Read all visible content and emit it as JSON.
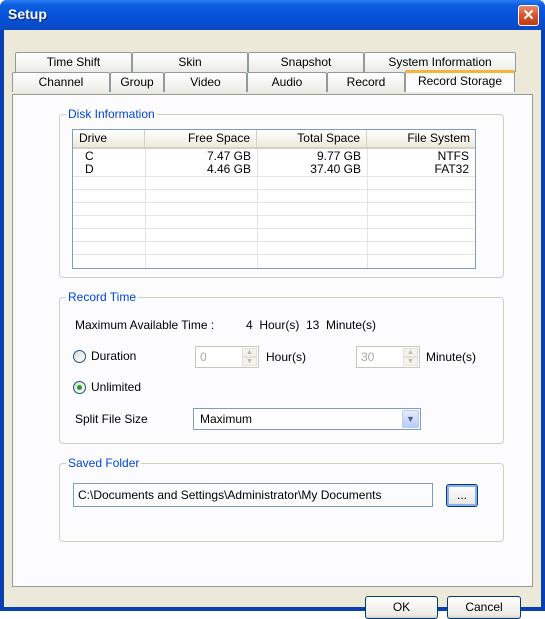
{
  "window": {
    "title": "Setup",
    "close_glyph": "✕"
  },
  "tabs_row1": [
    "Time Shift",
    "Skin",
    "Snapshot",
    "System Information"
  ],
  "tabs_row2": [
    "Channel",
    "Group",
    "Video",
    "Audio",
    "Record",
    "Record Storage"
  ],
  "active_tab": "Record Storage",
  "disk_info": {
    "legend": "Disk Information",
    "columns": [
      "Drive",
      "Free Space",
      "Total Space",
      "File System"
    ],
    "rows": [
      [
        "C",
        "7.47 GB",
        "9.77 GB",
        "NTFS"
      ],
      [
        "D",
        "4.46 GB",
        "37.40 GB",
        "FAT32"
      ]
    ]
  },
  "record_time": {
    "legend": "Record Time",
    "max_label": "Maximum Available Time :",
    "max_value": "4  Hour(s)  13  Minute(s)",
    "duration_label": "Duration",
    "hours_value": "0",
    "hours_label": "Hour(s)",
    "minutes_value": "30",
    "minutes_label": "Minute(s)",
    "unlimited_label": "Unlimited",
    "selected_mode": "Unlimited",
    "split_label": "Split File Size",
    "split_value": "Maximum"
  },
  "saved_folder": {
    "legend": "Saved Folder",
    "path": "C:\\Documents and Settings\\Administrator\\My Documents",
    "browse_label": "..."
  },
  "footer": {
    "ok_label": "OK",
    "cancel_label": "Cancel"
  },
  "icons": {
    "close": "close-icon",
    "spin_up": "chevron-up-icon",
    "spin_down": "chevron-down-icon",
    "dropdown": "chevron-down-icon"
  },
  "colors": {
    "titlebar": "#0550d6",
    "accent_tab": "#f8b33a",
    "legend_text": "#0046d5",
    "dialog_bg": "#ece9d8",
    "radio_dot": "#21a121"
  }
}
